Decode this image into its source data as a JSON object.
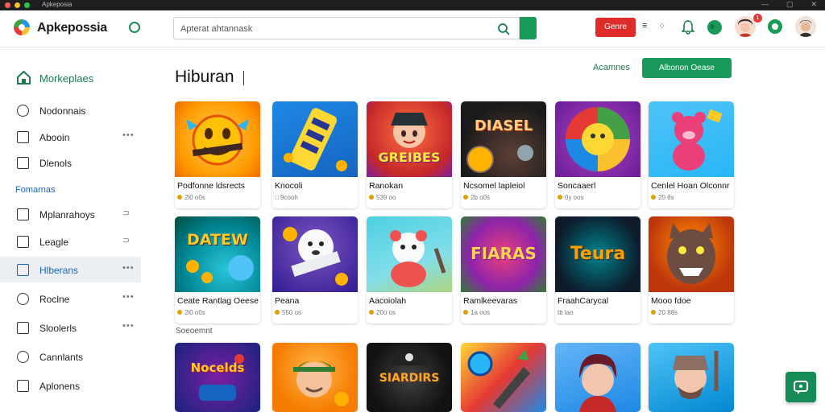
{
  "window": {
    "title": "Apkeposia"
  },
  "header": {
    "brand": "Apkepossia",
    "search_placeholder": "Apterat ahtannask",
    "red_button": "Genre",
    "symbols": {
      "menu": "≡",
      "apps": "⁘"
    },
    "notification_count": "1"
  },
  "sidebar": {
    "top_item": "Morkeplaes",
    "items_a": [
      "Nodonnais",
      "Abooin",
      "Dlenols"
    ],
    "section": "Fomarnas",
    "items_b": [
      "Mplanrahoys",
      "Leagle",
      "Hlberans",
      "Roclne",
      "Sloolerls",
      "Cannlants",
      "Aplonens"
    ],
    "more": "•••",
    "more_alt": "⊃"
  },
  "main": {
    "title": "Hiburan",
    "top_link": "Acamnes",
    "top_button": "Albonon Oease",
    "section_label": "Soeoemnt"
  },
  "cards_row1": [
    {
      "name": "Podfonne ldsrects",
      "meta": "2l0 o0s"
    },
    {
      "name": "Knocoli",
      "meta": "□ 9cooh"
    },
    {
      "name": "Ranokan",
      "meta": "539 oo"
    },
    {
      "name": "Ncsomel lapleiol",
      "meta": "2b o0s"
    },
    {
      "name": "Soncaaerl",
      "meta": "0y oos"
    },
    {
      "name": "Cenlel Hoan Olconnr",
      "meta": "20 8s"
    }
  ],
  "cards_row2": [
    {
      "name": "Ceate Rantlag Oeese",
      "meta": "2l0 o0s"
    },
    {
      "name": "Peana",
      "meta": "550 os"
    },
    {
      "name": "Aacoiolah",
      "meta": "20o os"
    },
    {
      "name": "Ramlkeevaras",
      "meta": "1a oos"
    },
    {
      "name": "FraahCarycal",
      "meta": "tb lao"
    },
    {
      "name": "Mooo fdoe",
      "meta": "20 88s"
    }
  ],
  "art_labels": {
    "r1c3": "GREIBES",
    "r1c4": "DIASEL",
    "r2c1": "DATEW",
    "r2c4": "FIARAS",
    "r2c5": "Teura",
    "r3c1": "Nocelds",
    "r3c3": "SIARDIRS"
  },
  "colors": {
    "brand_green": "#1a9a57",
    "accent_blue": "#1565c0",
    "alert_red": "#e02b2b"
  }
}
